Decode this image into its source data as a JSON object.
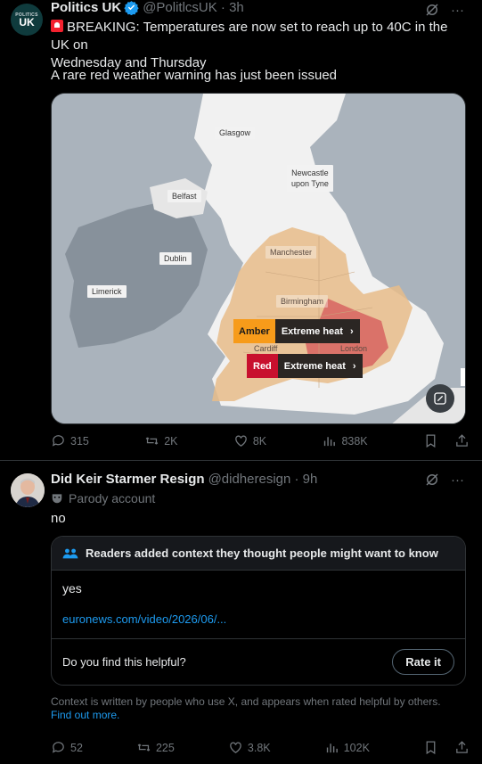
{
  "tweet1": {
    "avatar_small": "POLITICS",
    "avatar_large": "UK",
    "name": "Politics UK",
    "handle": "@PolitlcsUK · 3h",
    "line1": "BREAKING: Temperatures are now set to reach up to 40C in the UK on",
    "line2": "Wednesday and Thursday",
    "line3": "A rare red weather warning has just been issued",
    "map": {
      "labels": [
        "Glasgow",
        "Belfast",
        "Newcastle",
        "upon Tyne",
        "Dublin",
        "Limerick",
        "Manchester",
        "Birmingham",
        "Cardiff",
        "London"
      ],
      "amber_level": "Amber",
      "amber_desc": "Extreme heat",
      "red_level": "Red",
      "red_desc": "Extreme heat",
      "colors": {
        "amber": "#f79b1a",
        "red": "#c8102e",
        "amber_fill": "#e8bc8a"
      }
    },
    "actions": {
      "replies": "315",
      "reposts": "2K",
      "likes": "8K",
      "views": "838K"
    }
  },
  "tweet2": {
    "name": "Did Keir Starmer Resign",
    "handle": "@didheresign · 9h",
    "parody": "Parody account",
    "text": "no",
    "note": {
      "header": "Readers added context they thought people might want to know",
      "body": "yes",
      "link": "euronews.com/video/2026/06/...",
      "question": "Do you find this helpful?",
      "rate_label": "Rate it"
    },
    "context_text": "Context is written by people who use X, and appears when rated helpful by others.",
    "context_link": "Find out more.",
    "actions": {
      "replies": "52",
      "reposts": "225",
      "likes": "3.8K",
      "views": "102K"
    }
  }
}
